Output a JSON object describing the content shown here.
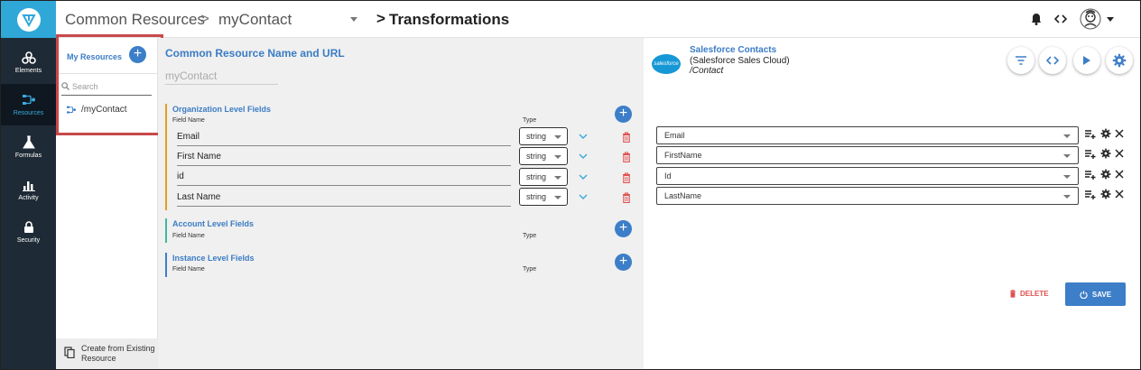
{
  "nav": {
    "items": [
      {
        "label": "Elements",
        "icon": "elements-icon"
      },
      {
        "label": "Resources",
        "icon": "resources-icon"
      },
      {
        "label": "Formulas",
        "icon": "flask-icon"
      },
      {
        "label": "Activity",
        "icon": "bar-chart-icon"
      },
      {
        "label": "Security",
        "icon": "lock-icon"
      }
    ],
    "active": "Resources"
  },
  "header": {
    "crumb1": "Common Resources",
    "crumb2": "myContact",
    "sep": ">",
    "crumb3": "Transformations"
  },
  "resources": {
    "title": "My Resources",
    "add_label": "+",
    "search_placeholder": "Search",
    "items": [
      "/myContact"
    ],
    "footer_label": "Create from Existing Resource"
  },
  "main": {
    "title": "Common Resource Name and URL",
    "name_value": "myContact",
    "sections": [
      {
        "title": "Organization Level Fields",
        "fieldname_header": "Field Name",
        "type_header": "Type",
        "color": "#e0a020",
        "fields": [
          {
            "name": "Email",
            "type": "string"
          },
          {
            "name": "First Name",
            "type": "string"
          },
          {
            "name": "id",
            "type": "string"
          },
          {
            "name": "Last Name",
            "type": "string"
          }
        ]
      },
      {
        "title": "Account Level Fields",
        "fieldname_header": "Field Name",
        "type_header": "Type",
        "color": "#3fb8a0",
        "fields": []
      },
      {
        "title": "Instance Level Fields",
        "fieldname_header": "Field Name",
        "type_header": "Type",
        "color": "#3d7ec8",
        "fields": []
      }
    ]
  },
  "mapping": {
    "logo_text": "salesforce",
    "title": "Salesforce Contacts",
    "subtitle": "(Salesforce Sales Cloud)",
    "path": "/Contact",
    "selects": [
      "Email",
      "FirstName",
      "Id",
      "LastName"
    ],
    "delete_label": "DELETE",
    "save_label": "SAVE"
  },
  "colors": {
    "accent": "#3d7ec8",
    "nav_bg": "#1e2a35",
    "logo_bg": "#2fa8d8",
    "danger": "#e05050",
    "highlight_box": "#c9484a"
  }
}
